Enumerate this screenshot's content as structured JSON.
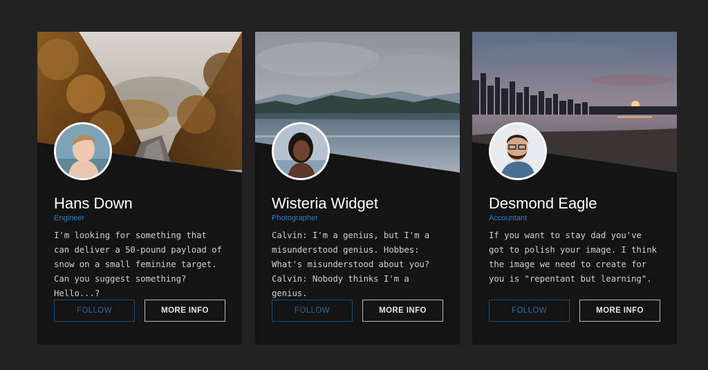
{
  "accent_color": "#2f7fc1",
  "cards": [
    {
      "name": "Hans Down",
      "role": "Engineer",
      "description": "I'm looking for something that can deliver a 50-pound payload of snow on a small feminine target. Can you suggest something? Hello...?",
      "follow_label": "FOLLOW",
      "more_label": "MORE INFO",
      "hero_image": "autumn-forest-road",
      "avatar_image": "young-blond-man"
    },
    {
      "name": "Wisteria Widget",
      "role": "Photographer",
      "description": "Calvin: I'm a genius, but I'm a misunderstood genius. Hobbes: What's misunderstood about you? Calvin: Nobody thinks I'm a genius.",
      "follow_label": "FOLLOW",
      "more_label": "MORE INFO",
      "hero_image": "mountain-lake",
      "avatar_image": "woman-in-water"
    },
    {
      "name": "Desmond Eagle",
      "role": "Accountant",
      "description": "If you want to stay dad you've got to polish your image. I think the image we need to create for you is \"repentant but learning\".",
      "follow_label": "FOLLOW",
      "more_label": "MORE INFO",
      "hero_image": "city-skyline-sunset-beach",
      "avatar_image": "bearded-man-glasses"
    }
  ]
}
